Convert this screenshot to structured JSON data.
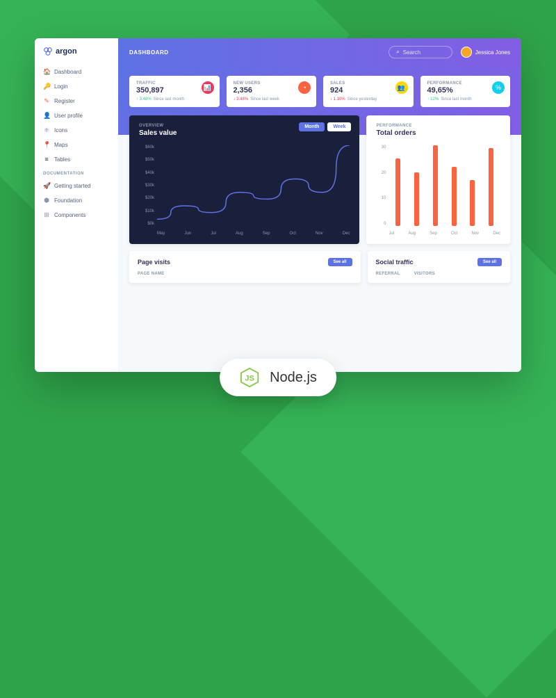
{
  "brand": "argon",
  "topbar": {
    "title": "DASHBOARD",
    "search_placeholder": "Search",
    "user_name": "Jessica Jones"
  },
  "sidebar": {
    "main": [
      {
        "label": "Dashboard",
        "icon": "🏠",
        "color": "#5e72e4"
      },
      {
        "label": "Login",
        "icon": "🔑",
        "color": "#11cdef"
      },
      {
        "label": "Register",
        "icon": "✎",
        "color": "#fb6340"
      },
      {
        "label": "User profile",
        "icon": "👤",
        "color": "#ffd600"
      },
      {
        "label": "Icons",
        "icon": "⚛",
        "color": "#5e72e4"
      },
      {
        "label": "Maps",
        "icon": "📍",
        "color": "#f5365c"
      },
      {
        "label": "Tables",
        "icon": "≡",
        "color": "#172b4d"
      }
    ],
    "docs_header": "DOCUMENTATION",
    "docs": [
      {
        "label": "Getting started",
        "icon": "🚀"
      },
      {
        "label": "Foundation",
        "icon": "⬢"
      },
      {
        "label": "Components",
        "icon": "⊞"
      }
    ]
  },
  "stats": [
    {
      "label": "TRAFFIC",
      "value": "350,897",
      "pct": "3.48%",
      "dir": "up",
      "since": "Since last month",
      "icon": "📊",
      "bg": "#f5365c"
    },
    {
      "label": "NEW USERS",
      "value": "2,356",
      "pct": "3.48%",
      "dir": "down",
      "since": "Since last week",
      "icon": "◔",
      "bg": "#fb6340"
    },
    {
      "label": "SALES",
      "value": "924",
      "pct": "1.10%",
      "dir": "down",
      "since": "Since yesterday",
      "icon": "👥",
      "bg": "#ffd600"
    },
    {
      "label": "PERFORMANCE",
      "value": "49,65%",
      "pct": "12%",
      "dir": "up",
      "since": "Since last month",
      "icon": "%",
      "bg": "#11cdef"
    }
  ],
  "sales": {
    "overline": "OVERVIEW",
    "title": "Sales value",
    "tabs": {
      "month": "Month",
      "week": "Week"
    }
  },
  "orders": {
    "overline": "PERFORMANCE",
    "title": "Total orders"
  },
  "page_visits": {
    "title": "Page visits",
    "see_all": "See all",
    "col1": "PAGE NAME"
  },
  "social_traffic": {
    "title": "Social traffic",
    "see_all": "See all",
    "col1": "REFERRAL",
    "col2": "VISITORS"
  },
  "badge": "Node.js",
  "chart_data": [
    {
      "type": "line",
      "title": "Sales value",
      "x": [
        "May",
        "Jun",
        "Jul",
        "Aug",
        "Sep",
        "Oct",
        "Nov",
        "Dec"
      ],
      "values": [
        5,
        15,
        10,
        25,
        20,
        35,
        25,
        60
      ],
      "ylabel": "$k",
      "ylim": [
        0,
        60
      ],
      "yticks": [
        "$60k",
        "$50k",
        "$40k",
        "$30k",
        "$20k",
        "$10k",
        "$0k"
      ]
    },
    {
      "type": "bar",
      "title": "Total orders",
      "categories": [
        "Jul",
        "Aug",
        "Sep",
        "Oct",
        "Nov",
        "Dec"
      ],
      "values": [
        25,
        20,
        30,
        22,
        17,
        29
      ],
      "ylim": [
        0,
        30
      ],
      "yticks": [
        "30",
        "20",
        "10",
        "0"
      ]
    }
  ]
}
